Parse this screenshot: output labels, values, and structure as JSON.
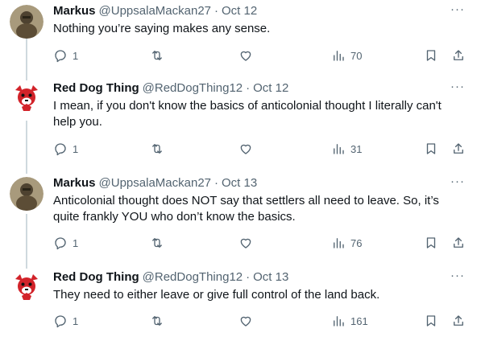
{
  "tweets": [
    {
      "name": "Markus",
      "handle": "@UppsalaMackan27",
      "separator": "·",
      "time": "Oct 12",
      "more": "···",
      "text": "Nothing you’re saying makes any sense.",
      "replies": "1",
      "views": "70",
      "avatar": "markus-avatar"
    },
    {
      "name": "Red Dog Thing",
      "handle": "@RedDogThing12",
      "separator": "·",
      "time": "Oct 12",
      "more": "···",
      "text": "I mean, if you don't know the basics of anticolonial thought I literally can't help you.",
      "replies": "1",
      "views": "31",
      "avatar": "red-dog-avatar"
    },
    {
      "name": "Markus",
      "handle": "@UppsalaMackan27",
      "separator": "·",
      "time": "Oct 13",
      "more": "···",
      "text": "Anticolonial thought does NOT say that settlers all need to leave. So, it’s quite frankly YOU who don’t know the basics.",
      "replies": "1",
      "views": "76",
      "avatar": "markus-avatar"
    },
    {
      "name": "Red Dog Thing",
      "handle": "@RedDogThing12",
      "separator": "·",
      "time": "Oct 13",
      "more": "···",
      "text": "They need to either leave or give full control of the land back.",
      "replies": "1",
      "views": "161",
      "avatar": "red-dog-avatar"
    }
  ],
  "icons": {
    "reply": "reply-icon",
    "retweet": "retweet-icon",
    "like": "heart-icon",
    "views": "views-icon",
    "bookmark": "bookmark-icon",
    "share": "share-icon"
  },
  "colors": {
    "text": "#0f1419",
    "secondary": "#536471",
    "thread_line": "#cfd9de",
    "red_dog": "#d2232a"
  }
}
